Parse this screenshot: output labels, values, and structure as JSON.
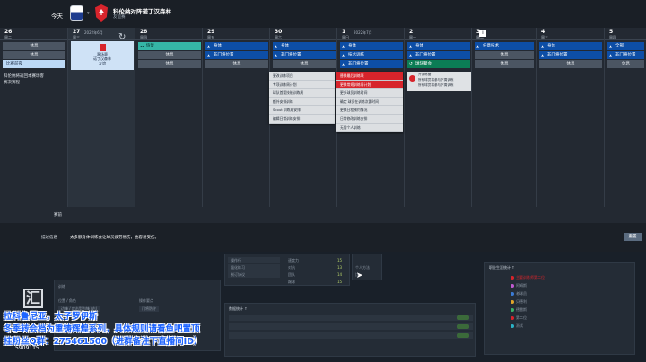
{
  "header": {
    "date_label": "今天",
    "match_title": "科伦纳对阵诺丁汉森林",
    "match_sub": "友谊赛"
  },
  "calendar": {
    "days": [
      {
        "num": "26",
        "dow": "周二",
        "month": "",
        "slots": [
          {
            "kind": "gray",
            "label": "休息"
          },
          {
            "kind": "gray",
            "label": "休息"
          },
          {
            "kind": "light",
            "label": "比赛前夜"
          }
        ],
        "note": [
          "科伦纳将返回本赛场客",
          "赛次赛程"
        ]
      },
      {
        "num": "27",
        "dow": "周三",
        "month": "2022年6月",
        "match_card": [
          "客场赛",
          "诺丁汉森林",
          "友谊"
        ]
      },
      {
        "num": "28",
        "dow": "周四",
        "month": "",
        "slots": [
          {
            "kind": "teal",
            "label": "恢复"
          },
          {
            "kind": "gray",
            "label": "休息"
          },
          {
            "kind": "gray",
            "label": "休息"
          }
        ]
      },
      {
        "num": "29",
        "dow": "周五",
        "month": "",
        "slots": [
          {
            "kind": "blue",
            "label": "身体"
          },
          {
            "kind": "blue",
            "label": "非门将位置"
          },
          {
            "kind": "gray",
            "label": "休息"
          }
        ]
      },
      {
        "num": "30",
        "dow": "周六",
        "month": "",
        "slots": [
          {
            "kind": "blue",
            "label": "身体"
          },
          {
            "kind": "blue",
            "label": "非门将位置"
          },
          {
            "kind": "gray",
            "label": "休息"
          }
        ]
      },
      {
        "num": "1",
        "dow": "周日",
        "month": "2022年7月",
        "slots": [
          {
            "kind": "blue",
            "label": "身体"
          },
          {
            "kind": "blue",
            "label": "技术训练"
          },
          {
            "kind": "blue",
            "label": "非门将位置"
          }
        ]
      },
      {
        "num": "2",
        "dow": "周一",
        "month": "",
        "slots": [
          {
            "kind": "blue",
            "label": "身体"
          },
          {
            "kind": "blue",
            "label": "非门将位置"
          },
          {
            "kind": "green",
            "label": "球队聚会"
          }
        ]
      },
      {
        "num": "3",
        "dow": "周二",
        "month": "",
        "slots": [
          {
            "kind": "blue",
            "label": "任意技术"
          },
          {
            "kind": "gray",
            "label": "休息"
          },
          {
            "kind": "gray",
            "label": "休息"
          }
        ]
      },
      {
        "num": "4",
        "dow": "周三",
        "month": "",
        "slots": [
          {
            "kind": "blue",
            "label": "身体"
          },
          {
            "kind": "blue",
            "label": "非门将位置"
          },
          {
            "kind": "gray",
            "label": "休息"
          }
        ]
      },
      {
        "num": "5",
        "dow": "周四",
        "month": "",
        "slots": [
          {
            "kind": "blue",
            "label": "全部"
          },
          {
            "kind": "blue",
            "label": "非门将位置"
          },
          {
            "kind": "gray",
            "label": "休息"
          }
        ]
      }
    ],
    "popup_left": [
      "更改训练项目",
      "专项训练周计划",
      "球队首要技能训练周",
      "额外安排训练",
      "Scout 训练周安排",
      "编辑日常训练安排"
    ],
    "popup_right": [
      "替换最后训练项",
      "更换常规训练周计划",
      "更多球员训练时间",
      "确定  球员在训练次要时间",
      "更换日程预约情况",
      "日常修改训练安排",
      "无需个人训练"
    ],
    "card_note": [
      "开训练营",
      "所有球员将参与下周训练",
      "所有球员将参与下周训练"
    ],
    "report_label": "赛前"
  },
  "description": {
    "label": "描述信息",
    "text": "太多额身体训练会让球员疲劳易伤，也容易受伤。",
    "button": "重置"
  },
  "background": {
    "left_labels": [
      "训练",
      "位置 / 角色",
      "边锋 / 攻击型内锋 (右)",
      "操作要点",
      "门将防守"
    ],
    "mid_labels": [
      "操作行",
      "强化练习",
      "制订协议",
      "速度力",
      "对抗",
      "团队",
      "踢球"
    ],
    "mid_values": [
      "15",
      "13",
      "14",
      "15",
      "14"
    ],
    "stats_title": "数据统计 ↑",
    "menu_labels": [
      "个人方法",
      "比"
    ],
    "right_title": "职业生涯统计 ↑",
    "right_items": [
      "主要训练师第二位",
      "阿姆斯",
      "老球员",
      "贝德利",
      "德雷斯",
      "第二位",
      "测试"
    ]
  },
  "overlay": {
    "line1": "拉科鲁尼亚，太子罗伊斯",
    "line2": "冬季转会档为重铸辉煌系列，具体规则请看鱼吧置顶",
    "line3": "挂粉丝Q群：275461500（进群备注下直播间ID）",
    "logo_glyph": "汇",
    "room_id": "5909115"
  },
  "colors": {
    "accent_blue": "#0d4ea6",
    "recovery_teal": "#35b5a6",
    "team_green": "#0b7d55",
    "rest_gray": "#4b5562",
    "alert_red": "#d7242b",
    "overlay_blue": "#1c63ff"
  }
}
